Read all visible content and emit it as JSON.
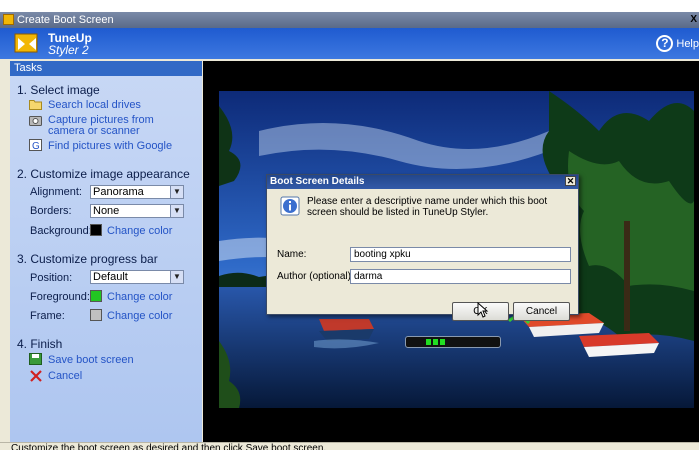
{
  "window": {
    "title": "Create Boot Screen",
    "close_glyph": "X"
  },
  "header": {
    "brand_line1": "TuneUp",
    "brand_line2": "Styler 2",
    "help_label": "Help"
  },
  "sidebar": {
    "tasks_label": "Tasks",
    "select_image": {
      "heading": "1. Select image",
      "links": [
        "Search local drives",
        "Capture pictures from camera or scanner",
        "Find pictures with Google"
      ]
    },
    "customize_image": {
      "heading": "2. Customize image appearance",
      "alignment_label": "Alignment:",
      "alignment_value": "Panorama",
      "borders_label": "Borders:",
      "borders_value": "None",
      "background_label": "Background:",
      "background_link": "Change color",
      "background_color": "#000000"
    },
    "customize_progress": {
      "heading": "3. Customize progress bar",
      "position_label": "Position:",
      "position_value": "Default",
      "foreground_label": "Foreground:",
      "foreground_link": "Change color",
      "foreground_color": "#22c522",
      "frame_label": "Frame:",
      "frame_link": "Change color",
      "frame_color": "#c0c0c0"
    },
    "finish": {
      "heading": "4. Finish",
      "save_label": "Save boot screen",
      "cancel_label": "Cancel"
    }
  },
  "dialog": {
    "title": "Boot Screen Details",
    "message": "Please enter a descriptive name under which this boot screen should be listed in TuneUp Styler.",
    "name_label": "Name:",
    "name_value": "booting xpku",
    "author_label": "Author (optional):",
    "author_value": "darma",
    "ok_label": "OK",
    "cancel_label": "Cancel"
  },
  "status_bar": {
    "text": "Customize the boot screen as desired and then click Save boot screen."
  }
}
